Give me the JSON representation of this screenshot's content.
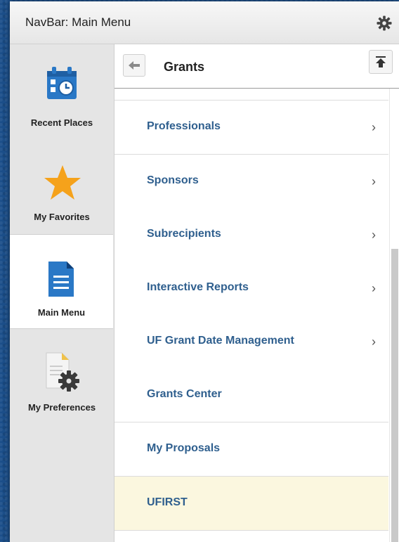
{
  "navbar": {
    "title": "NavBar: Main Menu",
    "settings_icon": "gear-icon"
  },
  "sidebar": {
    "items": [
      {
        "label": "Recent Places",
        "icon": "calendar-clock-icon"
      },
      {
        "label": "My Favorites",
        "icon": "star-icon"
      },
      {
        "label": "Main Menu",
        "icon": "document-icon",
        "active": true
      },
      {
        "label": "My Preferences",
        "icon": "document-gear-icon"
      }
    ]
  },
  "content": {
    "title": "Grants",
    "back_icon": "arrow-left-icon",
    "top_icon": "scroll-to-top-icon",
    "items": [
      {
        "label": "Professionals",
        "has_children": true
      },
      {
        "label": "Sponsors",
        "has_children": true
      },
      {
        "label": "Subrecipients",
        "has_children": true
      },
      {
        "label": "Interactive Reports",
        "has_children": true
      },
      {
        "label": "UF Grant Date Management",
        "has_children": true
      },
      {
        "label": "Grants Center",
        "has_children": false
      },
      {
        "label": "My Proposals",
        "has_children": false
      },
      {
        "label": "UFIRST",
        "has_children": false,
        "highlighted": true
      }
    ],
    "chevron": "›"
  },
  "colors": {
    "link": "#2f5f8e",
    "highlight": "#fbf7df",
    "star": "#f5a21b",
    "doc": "#2a78c6"
  }
}
